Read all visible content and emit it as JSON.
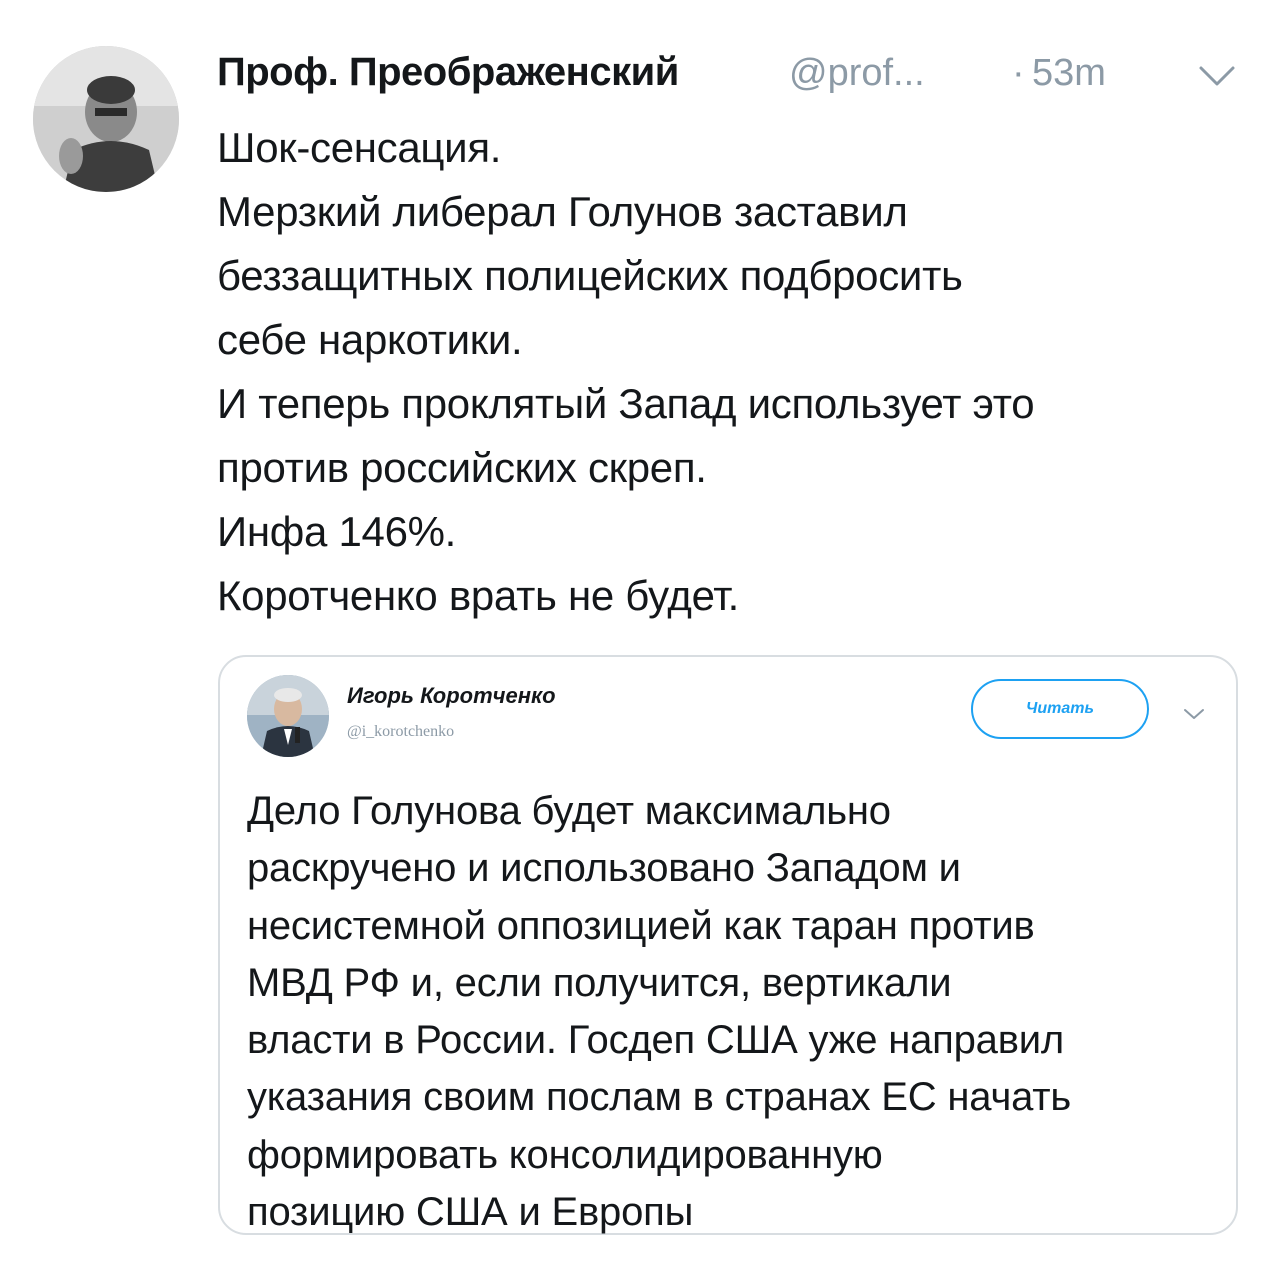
{
  "tweet": {
    "author": {
      "display_name": "Проф. Преображенский",
      "handle": "@prof...",
      "avatar_icon": "profile-photo-icon"
    },
    "separator": "·",
    "timestamp": "53m",
    "menu_icon": "chevron-down-icon",
    "text_lines": [
      "Шок-сенсация.",
      "Мерзкий либерал Голунов заставил",
      "беззащитных полицейских подбросить",
      "себе наркотики.",
      "И теперь проклятый Запад использует это",
      "против российских скреп.",
      "Инфа 146%.",
      "Коротченко врать не будет."
    ]
  },
  "quoted_tweet": {
    "author": {
      "display_name": "Игорь Коротченко",
      "handle": "@i_korotchenko",
      "avatar_icon": "profile-photo-icon"
    },
    "follow_label": "Читать",
    "menu_icon": "chevron-down-icon",
    "text_lines": [
      "Дело Голунова будет максимально",
      "раскручено и использовано Западом и",
      "несистемной оппозицией как таран против",
      "МВД РФ и, если получится, вертикали",
      "власти в России. Госдеп США уже направил",
      "указания своим послам в странах ЕС начать",
      "формировать консолидированную",
      "позицию США и Европы"
    ]
  },
  "colors": {
    "text": "#14171a",
    "secondary": "#8c9aa6",
    "accent": "#1da1f2",
    "border": "#d8dde1"
  }
}
